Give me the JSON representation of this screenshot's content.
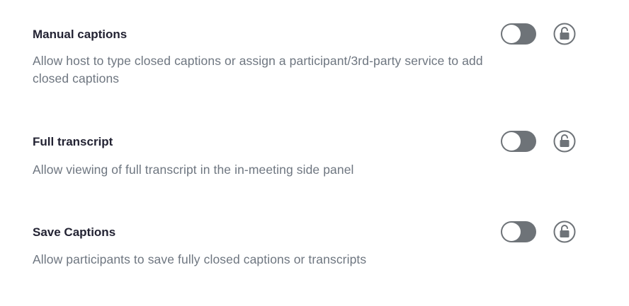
{
  "settings": [
    {
      "title": "Manual captions",
      "description": "Allow host to type closed captions or assign a participant/3rd-party service to add closed captions",
      "enabled": false,
      "lock_icon": "unlock-icon"
    },
    {
      "title": "Full transcript",
      "description": "Allow viewing of full transcript in the in-meeting side panel",
      "enabled": false,
      "lock_icon": "unlock-icon"
    },
    {
      "title": "Save Captions",
      "description": "Allow participants to save fully closed captions or transcripts",
      "enabled": false,
      "lock_icon": "unlock-icon"
    }
  ],
  "colors": {
    "title": "#232333",
    "description": "#6e7680",
    "toggle_off": "#6e7378",
    "icon": "#6e7378"
  }
}
